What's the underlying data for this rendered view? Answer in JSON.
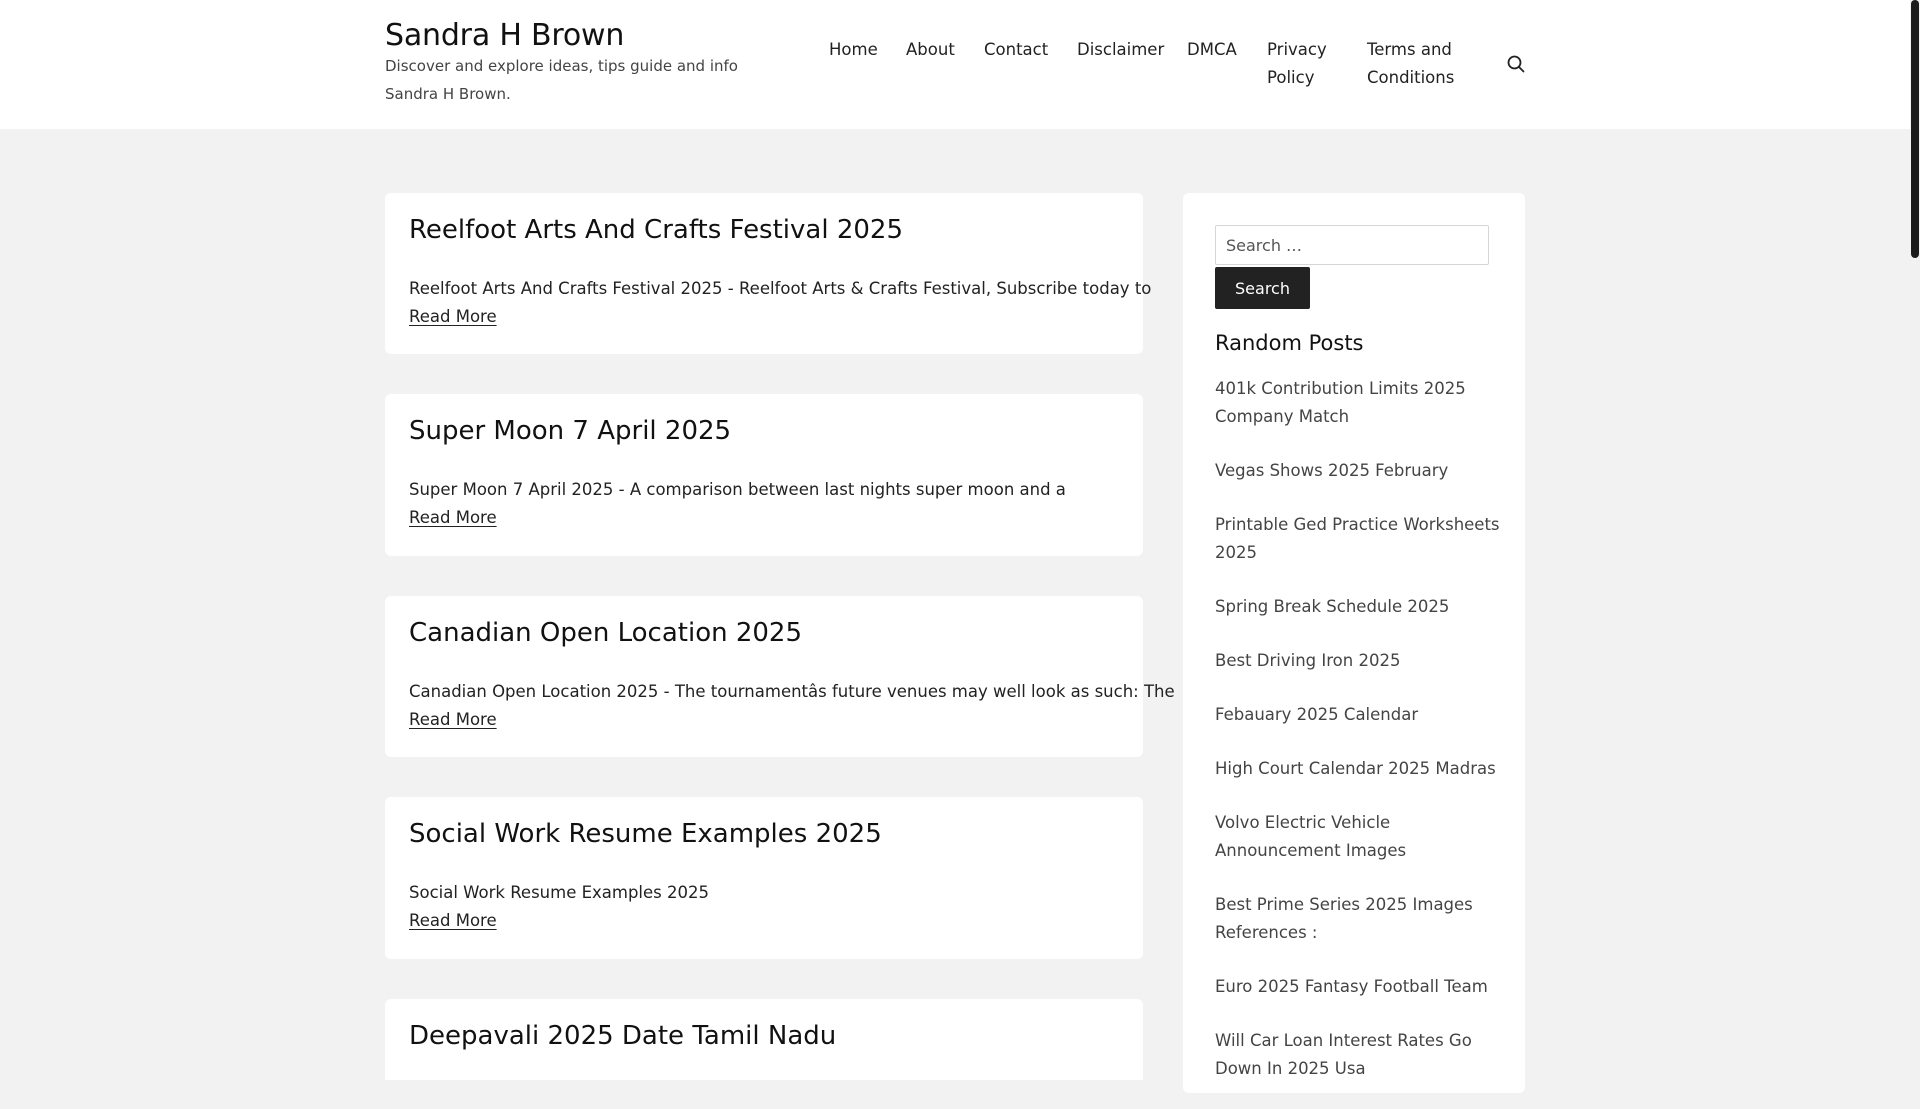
{
  "site": {
    "title": "Sandra H Brown",
    "description": "Discover and explore ideas, tips guide and info Sandra H Brown."
  },
  "nav": {
    "items": [
      {
        "label": "Home"
      },
      {
        "label": "About"
      },
      {
        "label": "Contact"
      },
      {
        "label": "Disclaimer"
      },
      {
        "label": "DMCA"
      },
      {
        "label": "Privacy Policy"
      },
      {
        "label": "Terms and Conditions"
      }
    ],
    "search_icon": "search-icon"
  },
  "posts": [
    {
      "title": "Reelfoot Arts And Crafts Festival 2025",
      "excerpt": "Reelfoot Arts And Crafts Festival 2025 - Reelfoot Arts & Crafts Festival, Subscribe today to",
      "read_more": "Read More"
    },
    {
      "title": "Super Moon 7 April 2025",
      "excerpt": "Super Moon 7 April 2025 - A comparison between last nights super moon and a",
      "read_more": "Read More"
    },
    {
      "title": "Canadian Open Location 2025",
      "excerpt": "Canadian Open Location 2025 - The tournamentâs future venues may well look as such: The",
      "read_more": "Read More"
    },
    {
      "title": "Social Work Resume Examples 2025",
      "excerpt": "Social Work Resume Examples 2025",
      "read_more": "Read More"
    },
    {
      "title": "Deepavali 2025 Date Tamil Nadu"
    }
  ],
  "sidebar": {
    "search": {
      "placeholder": "Search …",
      "button_label": "Search"
    },
    "random_posts": {
      "title": "Random Posts",
      "items": [
        "401k Contribution Limits 2025 Company Match",
        "Vegas Shows 2025 February",
        "Printable Ged Practice Worksheets 2025",
        "Spring Break Schedule 2025",
        "Best Driving Iron 2025",
        "Febauary 2025 Calendar",
        "High Court Calendar 2025 Madras",
        "Volvo Electric Vehicle Announcement Images",
        "Best Prime Series 2025 Images References :",
        "Euro 2025 Fantasy Football Team",
        "Will Car Loan Interest Rates Go Down In 2025 Usa"
      ]
    }
  },
  "colors": {
    "page_bg": "#f2f2f2",
    "card_bg": "#ffffff",
    "button_bg": "#222222",
    "text": "#111111"
  }
}
